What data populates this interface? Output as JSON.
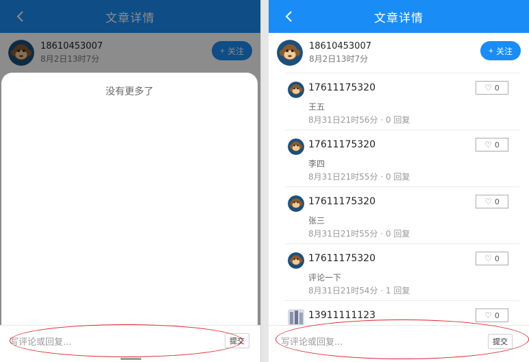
{
  "header": {
    "title": "文章详情"
  },
  "author": {
    "phone": "18610453007",
    "time": "8月2日13时7分"
  },
  "follow": {
    "plus": "+",
    "label": "关注"
  },
  "overlay": {
    "no_more": "没有更多了"
  },
  "comment_bar": {
    "placeholder": "写评论或回复...",
    "submit": "提交"
  },
  "comments": [
    {
      "user": "17611175320",
      "text": "王五",
      "stat": "8月31日21时56分 · 0 回复",
      "likes": "0"
    },
    {
      "user": "17611175320",
      "text": "李四",
      "stat": "8月31日21时55分 · 0 回复",
      "likes": "0"
    },
    {
      "user": "17611175320",
      "text": "张三",
      "stat": "8月31日21时55分 · 0 回复",
      "likes": "0"
    },
    {
      "user": "17611175320",
      "text": "评论一下",
      "stat": "8月31日21时54分 · 1 回复",
      "likes": "0"
    },
    {
      "user": "13911111123",
      "text": "",
      "stat": "",
      "likes": "0"
    }
  ],
  "colors": {
    "primary": "#1a8cf5",
    "annotation": "#d9262c"
  },
  "icons": {
    "back": "chevron-left-icon",
    "heart": "heart-icon",
    "avatar": "monkey-avatar"
  }
}
